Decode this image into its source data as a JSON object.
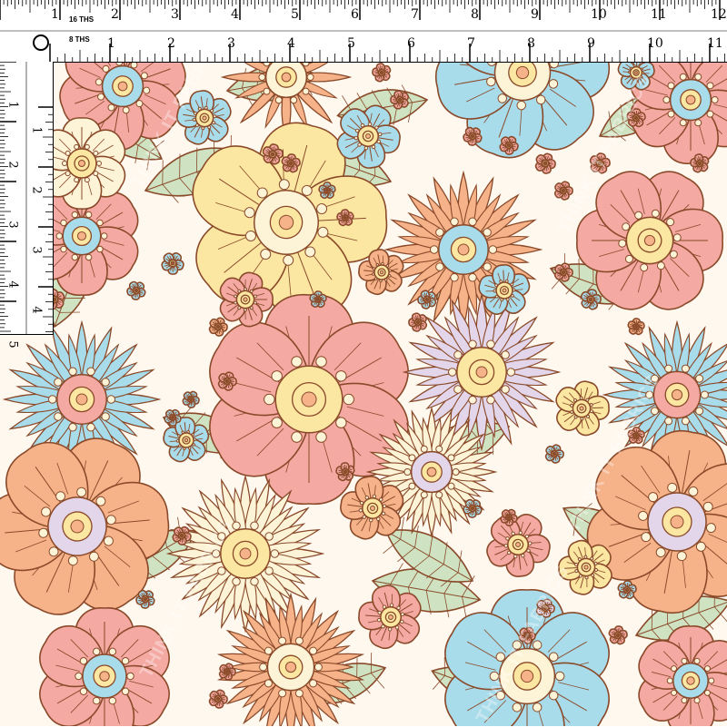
{
  "ruler": {
    "unit_label_top": "16 THS",
    "unit_label_bottom": "8 THS",
    "top_inches": [
      "1",
      "2",
      "3",
      "4",
      "5",
      "6",
      "7",
      "8",
      "9",
      "10",
      "11",
      "12"
    ],
    "bottom_inches": [
      "1",
      "2",
      "3",
      "4",
      "5",
      "6",
      "7",
      "8",
      "9",
      "10",
      "11"
    ],
    "left_inches_a": [
      "1",
      "2",
      "3",
      "4",
      "5"
    ],
    "left_inches_b": [
      "1",
      "2",
      "3",
      "4"
    ]
  },
  "watermark": {
    "text": "THINK IT FABRICS"
  },
  "pattern": {
    "name": "Retro pastel floral",
    "colors": {
      "outline": "#8a4a2a",
      "pink": "#f4a9a3",
      "peach": "#f6b38a",
      "yellow": "#fbe7a1",
      "blue": "#a9dcea",
      "lavender": "#e3d6ea",
      "cream": "#fdf4d8",
      "leaf": "#cfe3c2",
      "white": "#fff8ef"
    }
  }
}
